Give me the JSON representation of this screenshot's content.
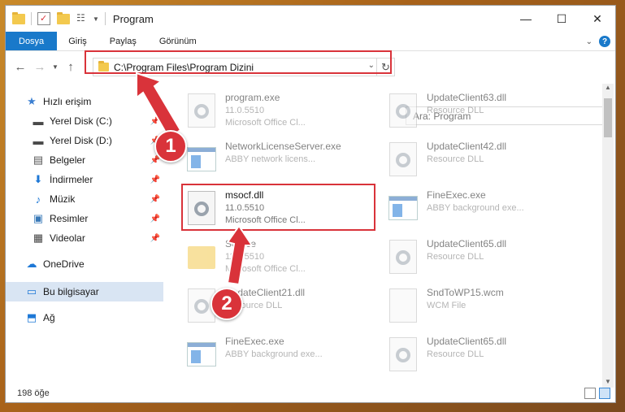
{
  "window": {
    "title": "Program",
    "controls": {
      "minimize": "—",
      "maximize": "☐",
      "close": "✕"
    }
  },
  "ribbon": {
    "tabs": [
      "Dosya",
      "Giriş",
      "Paylaş",
      "Görünüm"
    ],
    "expand_icon": "chevron-down-icon",
    "help_label": "?"
  },
  "address": {
    "path": "C:\\Program Files\\Program Dizini",
    "search_placeholder": "Ara: Program"
  },
  "sidebar": {
    "items": [
      {
        "label": "Hızlı erişim",
        "icon": "star-icon",
        "glyph": "★",
        "color": "#3b7fd1",
        "pinned": false
      },
      {
        "label": "Yerel Disk (C:)",
        "icon": "drive-icon",
        "glyph": "▬",
        "color": "#4a4a4a",
        "pinned": true
      },
      {
        "label": "Yerel Disk (D:)",
        "icon": "drive-icon",
        "glyph": "▬",
        "color": "#4a4a4a",
        "pinned": true
      },
      {
        "label": "Belgeler",
        "icon": "documents-icon",
        "glyph": "▤",
        "color": "#555",
        "pinned": true
      },
      {
        "label": "İndirmeler",
        "icon": "download-icon",
        "glyph": "⬇",
        "color": "#1e78d6",
        "pinned": true
      },
      {
        "label": "Müzik",
        "icon": "music-icon",
        "glyph": "♪",
        "color": "#1e78d6",
        "pinned": true
      },
      {
        "label": "Resimler",
        "icon": "pictures-icon",
        "glyph": "▣",
        "color": "#3a7ab8",
        "pinned": true
      },
      {
        "label": "Videolar",
        "icon": "video-icon",
        "glyph": "▦",
        "color": "#444",
        "pinned": true
      },
      {
        "label": "OneDrive",
        "icon": "cloud-icon",
        "glyph": "☁",
        "color": "#1e78d6",
        "pinned": false
      },
      {
        "label": "Bu bilgisayar",
        "icon": "computer-icon",
        "glyph": "▭",
        "color": "#1e78d6",
        "pinned": false
      },
      {
        "label": "Ağ",
        "icon": "network-icon",
        "glyph": "⬒",
        "color": "#1e78d6",
        "pinned": false
      }
    ]
  },
  "files": [
    {
      "name": "program.exe",
      "line2": "11.0.5510",
      "line3": "Microsoft Office Cl...",
      "icon": "exe-icon"
    },
    {
      "name": "UpdateClient63.dll",
      "line2": "Resource DLL",
      "line3": "",
      "icon": "dll-icon"
    },
    {
      "name": "NetworkLicenseServer.exe",
      "line2": "ABBY network licens...",
      "line3": "",
      "icon": "app-icon"
    },
    {
      "name": "UpdateClient42.dll",
      "line2": "Resource DLL",
      "line3": "",
      "icon": "dll-icon"
    },
    {
      "name": "msocf.dll",
      "line2": "11.0.5510",
      "line3": "Microsoft Office Cl...",
      "icon": "dll-icon"
    },
    {
      "name": "FineExec.exe",
      "line2": "ABBY background exe...",
      "line3": "",
      "icon": "app-icon"
    },
    {
      "name": "Source",
      "line2": "11.0.5510",
      "line3": "Microsoft Office Cl...",
      "icon": "folder-icon"
    },
    {
      "name": "UpdateClient65.dll",
      "line2": "Resource DLL",
      "line3": "",
      "icon": "dll-icon"
    },
    {
      "name": "UpdateClient21.dll",
      "line2": "Resource DLL",
      "line3": "",
      "icon": "dll-icon"
    },
    {
      "name": "SndToWP15.wcm",
      "line2": "WCM File",
      "line3": "",
      "icon": "file-icon"
    },
    {
      "name": "FineExec.exe",
      "line2": "ABBY background exe...",
      "line3": "",
      "icon": "app-icon"
    },
    {
      "name": "UpdateClient65.dll",
      "line2": "Resource DLL",
      "line3": "",
      "icon": "dll-icon"
    }
  ],
  "status": {
    "item_count": "198 öğe"
  },
  "annotations": {
    "step1": "1",
    "step2": "2",
    "color": "#d9333a"
  }
}
